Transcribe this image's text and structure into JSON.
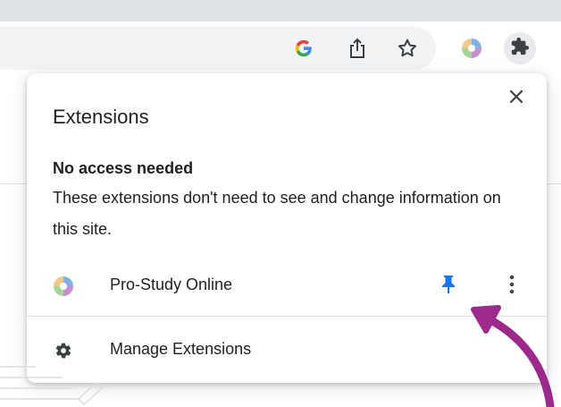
{
  "toolbar": {
    "google_icon": "google-g-icon",
    "share_icon": "share-icon",
    "bookmark_icon": "star-icon",
    "profile_icon": "pro-study-logo",
    "extensions_icon": "puzzle-icon"
  },
  "popup": {
    "title": "Extensions",
    "close_icon": "close-icon",
    "section_heading": "No access needed",
    "section_description": "These extensions don't need to see and change information on this site.",
    "extensions": [
      {
        "name": "Pro-Study Online",
        "pinned": true
      }
    ],
    "manage_label": "Manage Extensions"
  },
  "colors": {
    "pin": "#1a73e8",
    "arrow": "#9c2a8c",
    "text": "#202124"
  }
}
